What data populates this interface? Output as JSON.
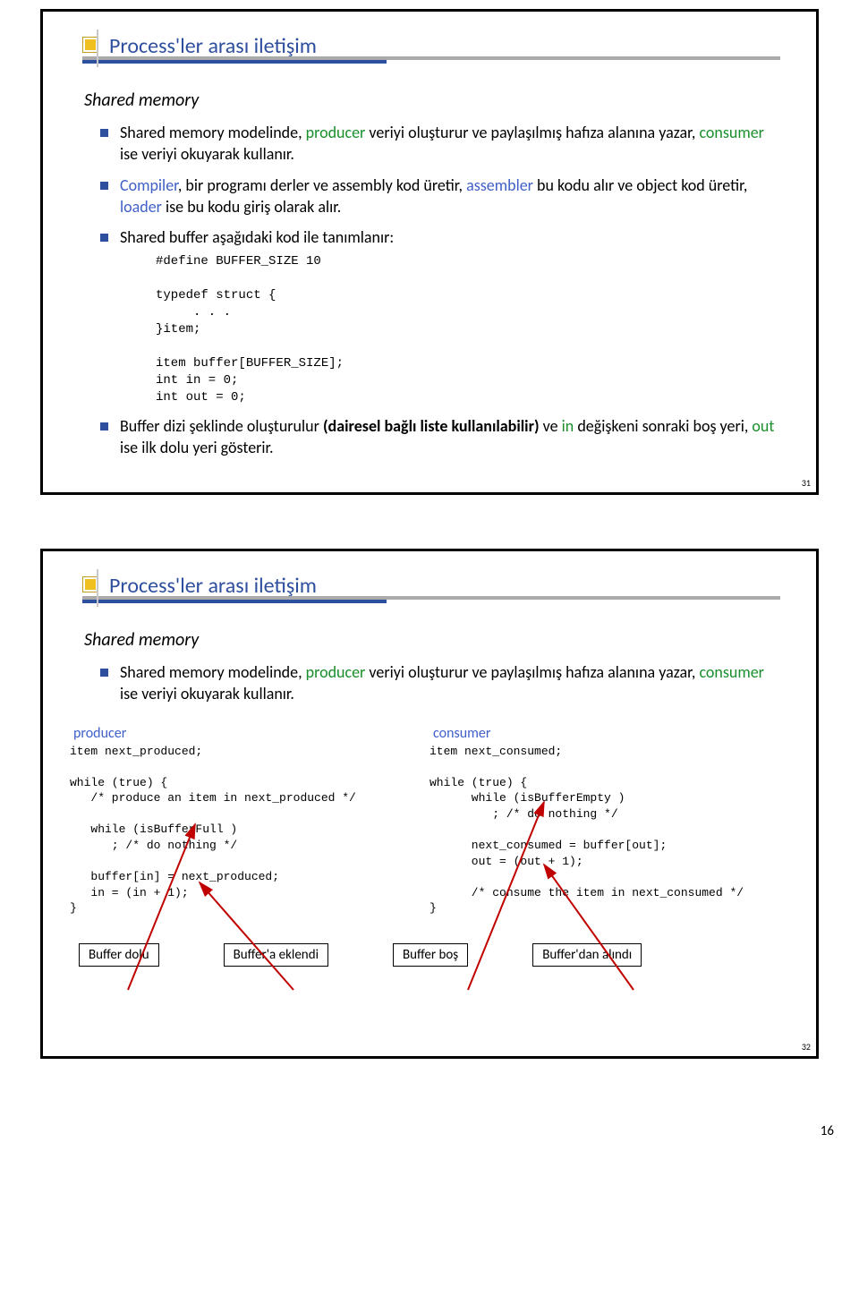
{
  "page_number": "16",
  "slide1": {
    "number": "31",
    "title": "Process'ler arası iletişim",
    "subheading": "Shared memory",
    "bullet1_plain1": "Shared memory modelinde, ",
    "bullet1_colored1": "producer ",
    "bullet1_plain2": "veriyi oluşturur ve paylaşılmış hafıza alanına yazar, ",
    "bullet1_colored2": "consumer ",
    "bullet1_plain3": "ise veriyi okuyarak kullanır.",
    "bullet2_p1": "Compiler",
    "bullet2_p2": ", bir programı derler ve assembly kod üretir, ",
    "bullet2_p3": "assembler ",
    "bullet2_p4": "bu kodu alır ve object kod üretir, ",
    "bullet2_p5": "loader ",
    "bullet2_p6": "ise bu kodu giriş olarak alır.",
    "bullet3": "Shared buffer aşağıdaki kod ile tanımlanır:",
    "code_define": "#define BUFFER_SIZE 10\n\ntypedef struct {\n     . . .\n}item;\n\nitem buffer[BUFFER_SIZE];\nint in = 0;\nint out = 0;",
    "bullet4_p1": "Buffer dizi şeklinde oluşturulur ",
    "bullet4_bold": "(dairesel bağlı liste kullanılabilir) ",
    "bullet4_p2": "ve ",
    "bullet4_c1": "in ",
    "bullet4_p3": "değişkeni sonraki boş yeri, ",
    "bullet4_c2": "out ",
    "bullet4_p4": "ise ilk dolu yeri gösterir."
  },
  "slide2": {
    "number": "32",
    "title": "Process'ler arası iletişim",
    "subheading": "Shared memory",
    "bullet1_plain1": "Shared memory modelinde, ",
    "bullet1_colored1": "producer ",
    "bullet1_plain2": "veriyi oluşturur ve paylaşılmış hafıza alanına yazar, ",
    "bullet1_colored2": "consumer ",
    "bullet1_plain3": "ise veriyi okuyarak kullanır.",
    "label_producer": "producer",
    "label_consumer": "consumer",
    "code_producer": "item next_produced;\n\nwhile (true) {\n   /* produce an item in next_produced */\n\n   while (isBufferFull )\n      ; /* do nothing */\n\n   buffer[in] = next_produced;\n   in = (in + 1);\n}",
    "code_consumer": "item next_consumed;\n\nwhile (true) {\n      while (isBufferEmpty )\n         ; /* do nothing */\n\n      next_consumed = buffer[out];\n      out = (out + 1);\n\n      /* consume the item in next_consumed */\n}",
    "box1": "Buffer dolu",
    "box2": "Buffer'a eklendi",
    "box3": "Buffer boş",
    "box4": "Buffer'dan alındı"
  }
}
